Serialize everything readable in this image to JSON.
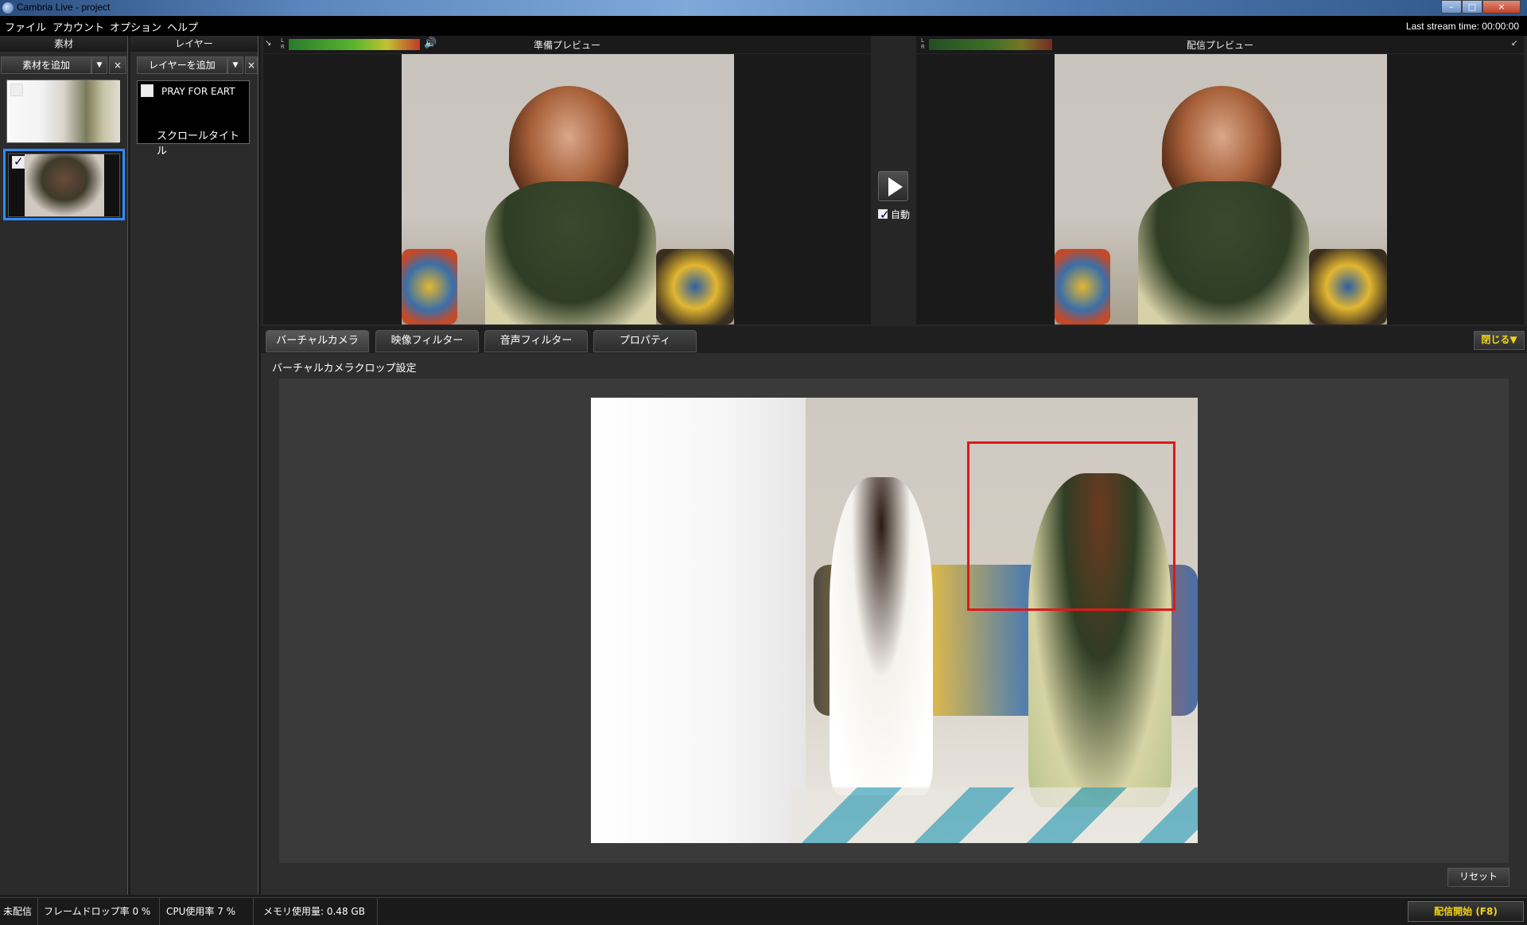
{
  "window": {
    "title": "Cambria Live - project"
  },
  "menu": {
    "items": [
      "ファイル",
      "アカウント",
      "オプション",
      "ヘルプ"
    ]
  },
  "stream_time": "Last stream time: 00:00:00",
  "sources": {
    "header": "素材",
    "add_button": "素材を追加",
    "close_label": "×",
    "dropdown_label": "▼"
  },
  "layers": {
    "header": "レイヤー",
    "add_button": "レイヤーを追加",
    "close_label": "×",
    "dropdown_label": "▼",
    "items": [
      {
        "title": "PRAY FOR EART",
        "subtitle": "スクロールタイトル"
      }
    ]
  },
  "preview": {
    "title": "準備プレビュー",
    "expand_label": "↘"
  },
  "program": {
    "title": "配信プレビュー",
    "collapse_label": "↙"
  },
  "transition": {
    "auto_label": "自動"
  },
  "tabs": [
    "バーチャルカメラ",
    "映像フィルター",
    "音声フィルター",
    "プロパティ"
  ],
  "close_panel_label": "閉じる▼",
  "crop": {
    "title": "バーチャルカメラクロップ設定",
    "reset_label": "リセット"
  },
  "status": {
    "state": "未配信",
    "frame_drop": "フレームドロップ率  0  %",
    "cpu": "CPU使用率 7 %",
    "memory": "メモリ使用量: 0.48 GB",
    "start_button": "配信開始 (F8)"
  },
  "colors": {
    "accent_yellow": "#f2d21b",
    "selection_blue": "#2d8cff",
    "crop_red": "#e01818"
  }
}
